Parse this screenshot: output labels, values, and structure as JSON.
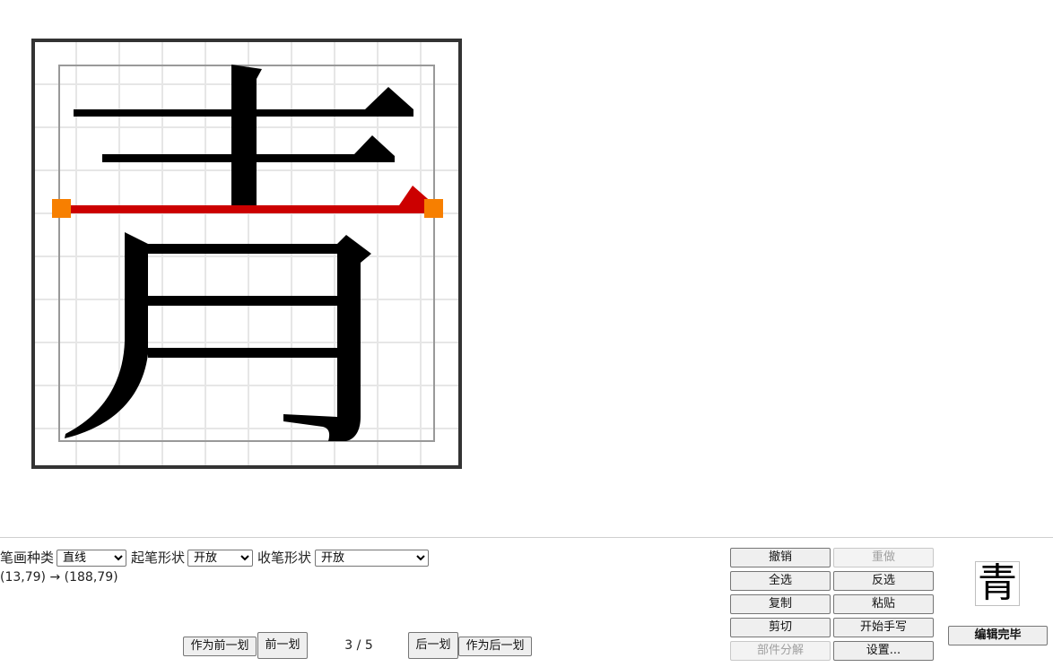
{
  "editor": {
    "character": "青",
    "selected_stroke": {
      "start": "(13,79)",
      "arrow": "→",
      "end": "(188,79)"
    }
  },
  "controls": {
    "stroke_type_label": "笔画种类",
    "stroke_type_value": "直线",
    "start_shape_label": "起笔形状",
    "start_shape_value": "开放",
    "end_shape_label": "收笔形状",
    "end_shape_value": "开放"
  },
  "navigation": {
    "set_as_prev_label": "作为前一划",
    "prev_label": "前一划",
    "current": "3",
    "separator": "/",
    "total": "5",
    "next_label": "后一划",
    "set_as_next_label": "作为后一划"
  },
  "actions": {
    "undo": "撤销",
    "redo": "重做",
    "select_all": "全选",
    "invert_select": "反选",
    "copy": "复制",
    "paste": "粘贴",
    "cut": "剪切",
    "handwrite": "开始手写",
    "decompose": "部件分解",
    "settings": "设置...",
    "done": "编辑完毕"
  },
  "colors": {
    "selected_stroke": "#cc0000",
    "handle": "#f77f00",
    "glyph": "#000000",
    "grid": "#e6e6e6",
    "frame": "#333333",
    "guide": "#999999"
  },
  "icons": {
    "handle": "square-handle-icon"
  }
}
